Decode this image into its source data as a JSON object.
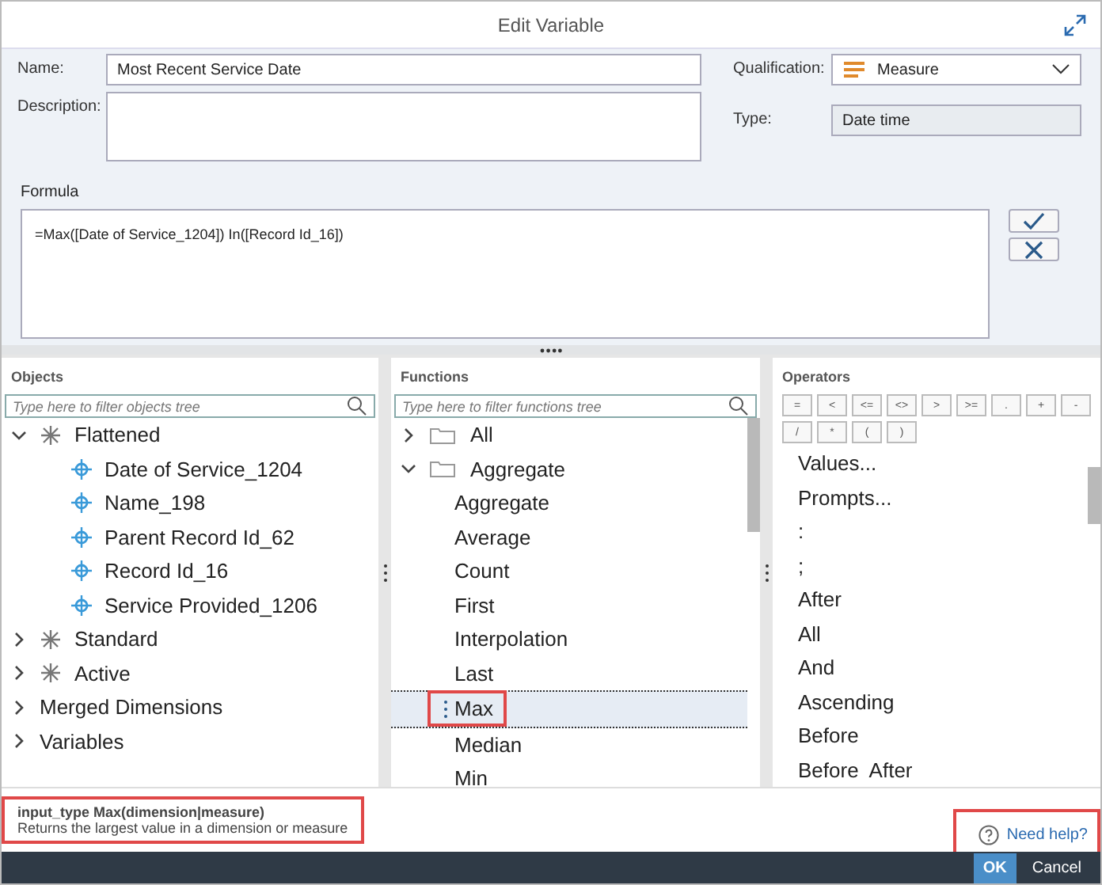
{
  "window": {
    "title": "Edit Variable"
  },
  "form": {
    "name_label": "Name:",
    "name_value": "Most Recent Service Date",
    "description_label": "Description:",
    "qualification_label": "Qualification:",
    "qualification_value": "Measure",
    "type_label": "Type:",
    "type_value": "Date time"
  },
  "formula": {
    "label": "Formula",
    "value": "=Max([Date of Service_1204]) In([Record Id_16])"
  },
  "objects": {
    "title": "Objects",
    "placeholder": "Type here to filter objects tree",
    "items": [
      {
        "label": "Flattened",
        "kind": "folder",
        "expanded": true,
        "children": [
          {
            "label": "Date of Service_1204",
            "kind": "dimension"
          },
          {
            "label": "Name_198",
            "kind": "dimension"
          },
          {
            "label": "Parent Record Id_62",
            "kind": "dimension"
          },
          {
            "label": "Record Id_16",
            "kind": "dimension"
          },
          {
            "label": "Service Provided_1206",
            "kind": "dimension"
          }
        ]
      },
      {
        "label": "Standard",
        "kind": "folder",
        "expanded": false
      },
      {
        "label": "Active",
        "kind": "folder",
        "expanded": false
      },
      {
        "label": "Merged Dimensions",
        "kind": "plain",
        "expanded": false
      },
      {
        "label": "Variables",
        "kind": "plain",
        "expanded": false
      }
    ]
  },
  "functions": {
    "title": "Functions",
    "placeholder": "Type here to filter functions tree",
    "items": [
      {
        "label": "All",
        "expanded": false
      },
      {
        "label": "Aggregate",
        "expanded": true,
        "children": [
          {
            "label": "Aggregate",
            "selected": false,
            "highlighted": false
          },
          {
            "label": "Average",
            "selected": false,
            "highlighted": false
          },
          {
            "label": "Count",
            "selected": false,
            "highlighted": false
          },
          {
            "label": "First",
            "selected": false,
            "highlighted": false
          },
          {
            "label": "Interpolation",
            "selected": false,
            "highlighted": false
          },
          {
            "label": "Last",
            "selected": false,
            "highlighted": false
          },
          {
            "label": "Max",
            "selected": true,
            "highlighted": true
          },
          {
            "label": "Median",
            "selected": false,
            "highlighted": false
          },
          {
            "label": "Min",
            "selected": false,
            "highlighted": false
          }
        ]
      }
    ]
  },
  "operators": {
    "title": "Operators",
    "buttons": [
      "=",
      "<",
      "<=",
      "<>",
      ">",
      ">=",
      ".",
      "+",
      "-",
      "/",
      "*",
      "(",
      ")"
    ],
    "items": [
      "Values...",
      "Prompts...",
      ":",
      ";",
      "After",
      "All",
      "And",
      "Ascending",
      "Before",
      "Before  After"
    ]
  },
  "info": {
    "signature_prefix": "input_type",
    "signature": "Max(dimension|measure)",
    "description": "Returns the largest value in a dimension or measure",
    "highlighted": true
  },
  "help_link": {
    "label": "Need help?",
    "highlighted": true
  },
  "footer": {
    "buttons": [
      "OK",
      "Cancel"
    ]
  }
}
